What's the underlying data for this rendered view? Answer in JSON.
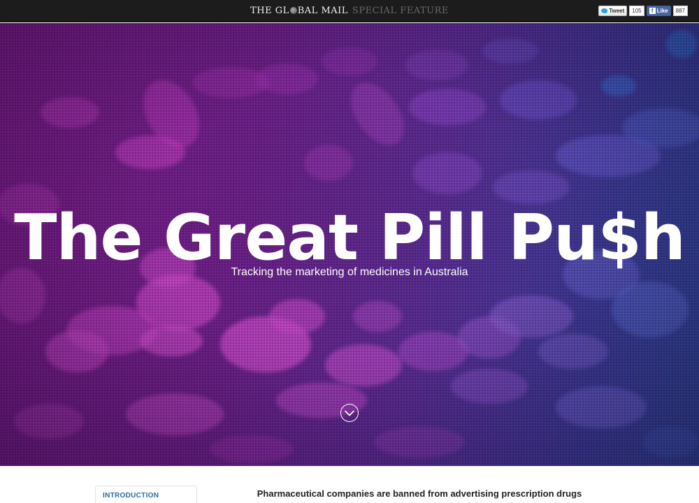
{
  "header": {
    "brand_name": "THE GL",
    "brand_name_rest": "BAL MAIL",
    "feature_label": "SPECIAL FEATURE",
    "social": {
      "tweet_label": "Tweet",
      "tweet_count": "105",
      "like_label": "Like",
      "like_count": "887"
    }
  },
  "hero": {
    "title": "The Great Pill Pu$h",
    "subtitle": "Tracking the marketing of medicines in Australia",
    "scroll_icon": "chevron-down-circle-icon"
  },
  "sidebar": {
    "items": [
      {
        "label": "INTRODUCTION"
      }
    ]
  },
  "main": {
    "intro_text": "Pharmaceutical companies are banned from advertising prescription drugs directly to Australian consumers. But they can promote their products to"
  },
  "colors": {
    "topbar": "#1c1c1c",
    "hero_magenta": "#7a1f86",
    "hero_blue": "#2d4a96",
    "accent_link": "#2a6aa6"
  }
}
